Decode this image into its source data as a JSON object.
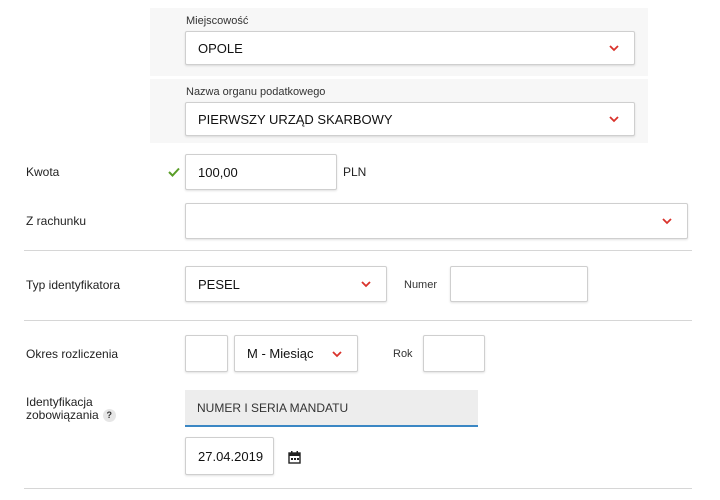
{
  "city": {
    "label": "Miejscowość",
    "value": "OPOLE"
  },
  "tax_office": {
    "label": "Nazwa organu podatkowego",
    "value": "PIERWSZY URZĄD SKARBOWY"
  },
  "amount": {
    "label": "Kwota",
    "value": "100,00",
    "currency": "PLN"
  },
  "account": {
    "label": "Z rachunku",
    "value": ""
  },
  "identifier": {
    "label": "Typ identyfikatora",
    "type_value": "PESEL",
    "number_label": "Numer",
    "number_value": ""
  },
  "period": {
    "label": "Okres rozliczenia",
    "first_value": "",
    "month_value": "M - Miesiąc",
    "year_label": "Rok",
    "year_value": ""
  },
  "obligation": {
    "label_line1": "Identyfikacja",
    "label_line2": "zobowiązania",
    "help": "?",
    "value": "NUMER I SERIA MANDATU",
    "date": "27.04.2019"
  },
  "colors": {
    "chevron": "#d9322b",
    "check": "#5a9e28",
    "focus": "#3b87c4"
  }
}
